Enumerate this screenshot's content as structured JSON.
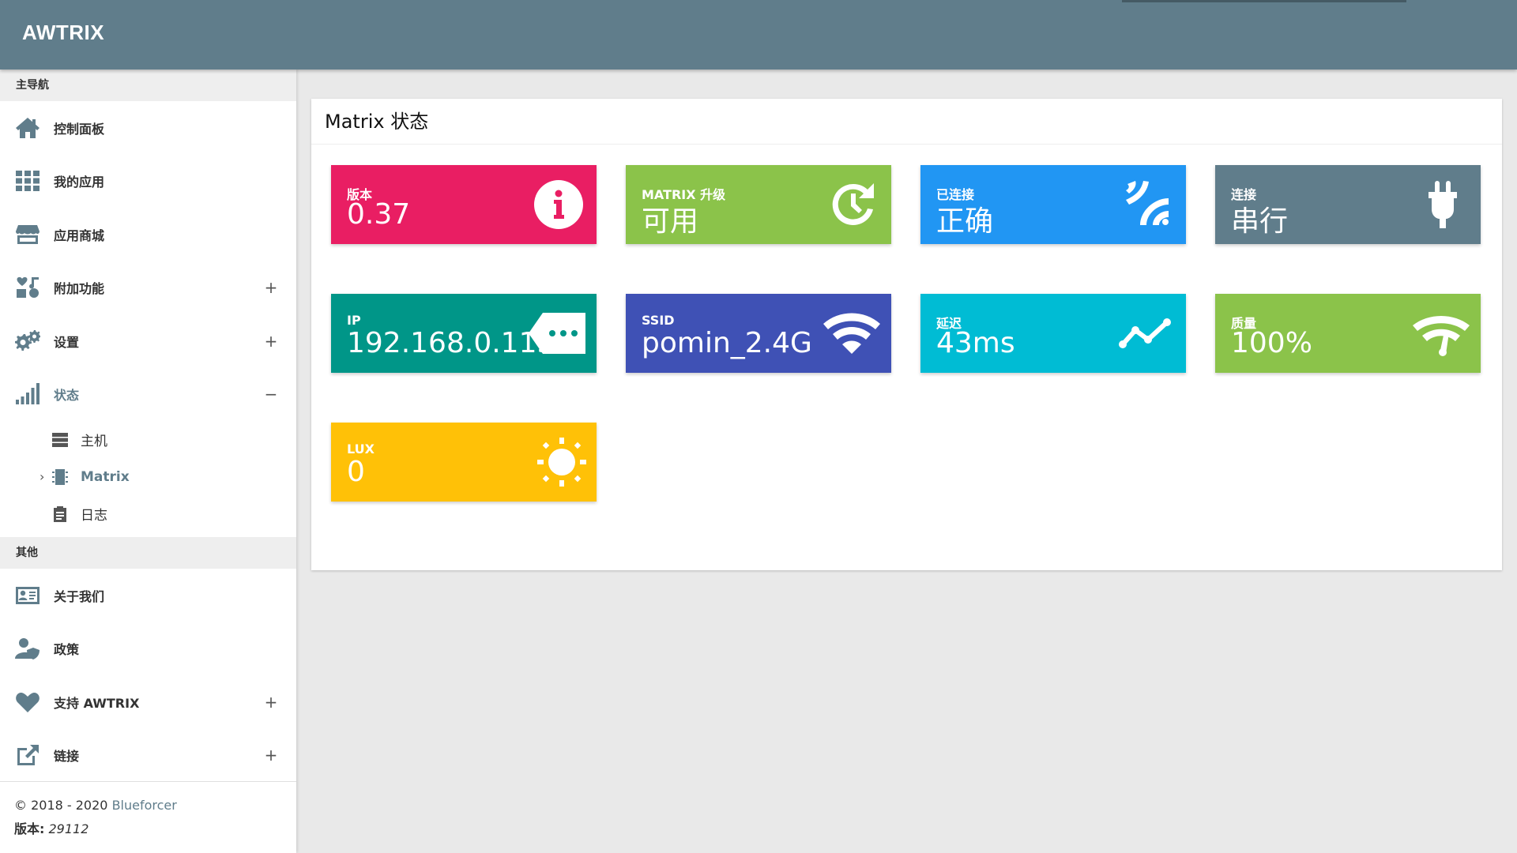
{
  "app": {
    "title": "AWTRIX"
  },
  "sidebar": {
    "section_main": "主导航",
    "items": [
      {
        "label": "控制面板",
        "icon": "home-icon"
      },
      {
        "label": "我的应用",
        "icon": "apps-grid-icon"
      },
      {
        "label": "应用商城",
        "icon": "store-icon"
      },
      {
        "label": "附加功能",
        "icon": "extras-icon",
        "toggle": "+"
      },
      {
        "label": "设置",
        "icon": "gears-icon",
        "toggle": "+"
      },
      {
        "label": "状态",
        "icon": "signal-bars-icon",
        "toggle": "−"
      }
    ],
    "sub_items": [
      {
        "label": "主机",
        "icon": "server-icon"
      },
      {
        "label": "Matrix",
        "icon": "chip-icon"
      },
      {
        "label": "日志",
        "icon": "clipboard-icon"
      }
    ],
    "section_other": "其他",
    "other_items": [
      {
        "label": "关于我们",
        "icon": "id-card-icon"
      },
      {
        "label": "政策",
        "icon": "user-shield-icon"
      },
      {
        "label": "支持 AWTRIX",
        "icon": "heart-icon",
        "toggle": "+"
      },
      {
        "label": "链接",
        "icon": "external-link-icon",
        "toggle": "+"
      }
    ],
    "footer": {
      "copyright": "© 2018 - 2020 ",
      "author": "Blueforcer",
      "version_label": "版本:",
      "version_value": "29112"
    }
  },
  "main": {
    "card_title": "Matrix 状态",
    "tiles": [
      {
        "label": "版本",
        "value": "0.37",
        "color": "#e91e63",
        "icon": "info-icon"
      },
      {
        "label": "MATRIX 升级",
        "value": "可用",
        "color": "#8bc34a",
        "icon": "update-clock-icon"
      },
      {
        "label": "已连接",
        "value": "正确",
        "color": "#2196f3",
        "icon": "wireless-signal-icon"
      },
      {
        "label": "连接",
        "value": "串行",
        "color": "#607d8b",
        "icon": "plug-icon"
      },
      {
        "label": "IP",
        "value": "192.168.0.113",
        "color": "#009688",
        "icon": "tag-dots-icon"
      },
      {
        "label": "SSID",
        "value": "pomin_2.4G",
        "color": "#3f51b5",
        "icon": "wifi-icon"
      },
      {
        "label": "延迟",
        "value": "43ms",
        "color": "#00bcd4",
        "icon": "line-graph-icon"
      },
      {
        "label": "质量",
        "value": "100%",
        "color": "#8bc34a",
        "icon": "wifi-gauge-icon"
      },
      {
        "label": "LUX",
        "value": "0",
        "color": "#ffc107",
        "icon": "sun-icon"
      }
    ]
  }
}
